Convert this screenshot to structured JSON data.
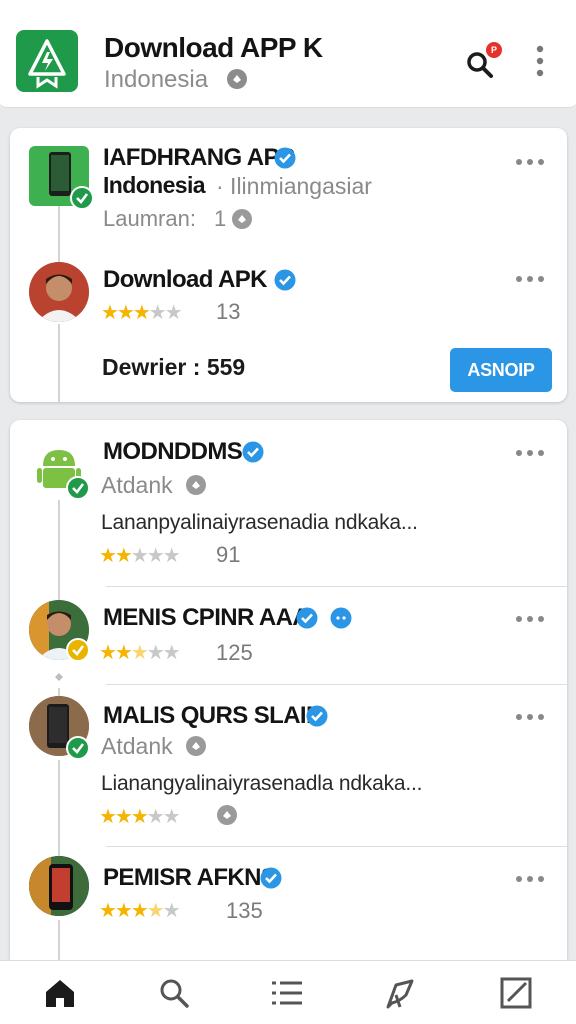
{
  "header": {
    "title": "Download APP K",
    "subtitle": "Indonesia",
    "badge": "P",
    "logo_icon": "android-warning-logo",
    "colors": {
      "brand": "#1f9a4a",
      "badge": "#e5322b"
    }
  },
  "featured": {
    "app": {
      "name": "IAFDHRANG APP",
      "region": "Indonesia",
      "category": "· Ilinmiangasiar",
      "launch_label": "Laumran:",
      "launch_value": "1"
    },
    "review": {
      "name": "Download APK",
      "rating": 3,
      "count": "13"
    },
    "downloads": "Dewrier : 559",
    "cta_label": "ASNOIP",
    "colors": {
      "cta": "#2a96e5",
      "verified": "#2a96e5",
      "star": "#f5b400"
    }
  },
  "feed": [
    {
      "name": "MODNDDMS",
      "sub": "Atdank",
      "text": "Lananpyalinaiyrasenadia ndkaka...",
      "rating": 2,
      "count": "91"
    },
    {
      "name": "MENIS CPINR AAA",
      "rating": 2.5,
      "count": "125"
    },
    {
      "name": "MALIS QURS SLAIN",
      "sub": "Atdank",
      "text": "Lianangyalinaiyrasenadla ndkaka...",
      "rating": 3
    },
    {
      "name": "PEMISR AFKNS",
      "rating": 3.5,
      "count": "135"
    }
  ],
  "bottom_nav": [
    "home-icon",
    "search-icon",
    "list-icon",
    "share-icon",
    "edit-icon"
  ]
}
